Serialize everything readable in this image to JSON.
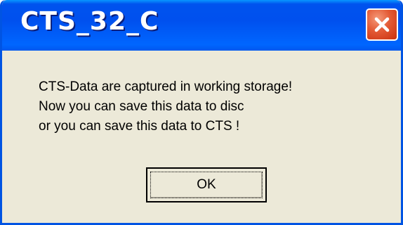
{
  "window": {
    "title": "CTS_32_C",
    "close_icon": "close-icon"
  },
  "dialog": {
    "message_lines": [
      "CTS-Data are captured in working storage!",
      "Now you can save this data to disc",
      "or you can save this data to CTS !"
    ],
    "ok_label": "OK"
  },
  "colors": {
    "titlebar": "#0054e3",
    "close_button": "#e35a35",
    "dialog_background": "#ece9d8"
  }
}
